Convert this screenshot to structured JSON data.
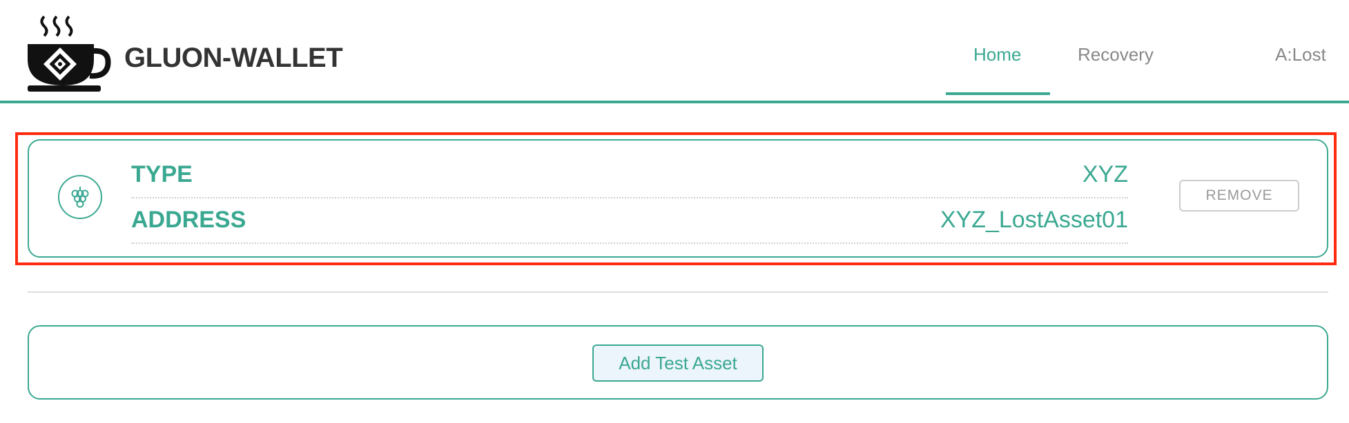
{
  "app": {
    "brand": "GLUON-WALLET"
  },
  "nav": {
    "home": "Home",
    "recovery": "Recovery",
    "account": "A:Lost",
    "active": "Home"
  },
  "asset": {
    "icon": "grapes-icon",
    "type_label": "TYPE",
    "type_value": "XYZ",
    "address_label": "ADDRESS",
    "address_value": "XYZ_LostAsset01",
    "remove_label": "REMOVE"
  },
  "actions": {
    "add_test_asset": "Add Test Asset"
  },
  "colors": {
    "accent": "#3aa891",
    "highlight": "#ff2a10",
    "add_button_bg": "#ecf4fc"
  }
}
